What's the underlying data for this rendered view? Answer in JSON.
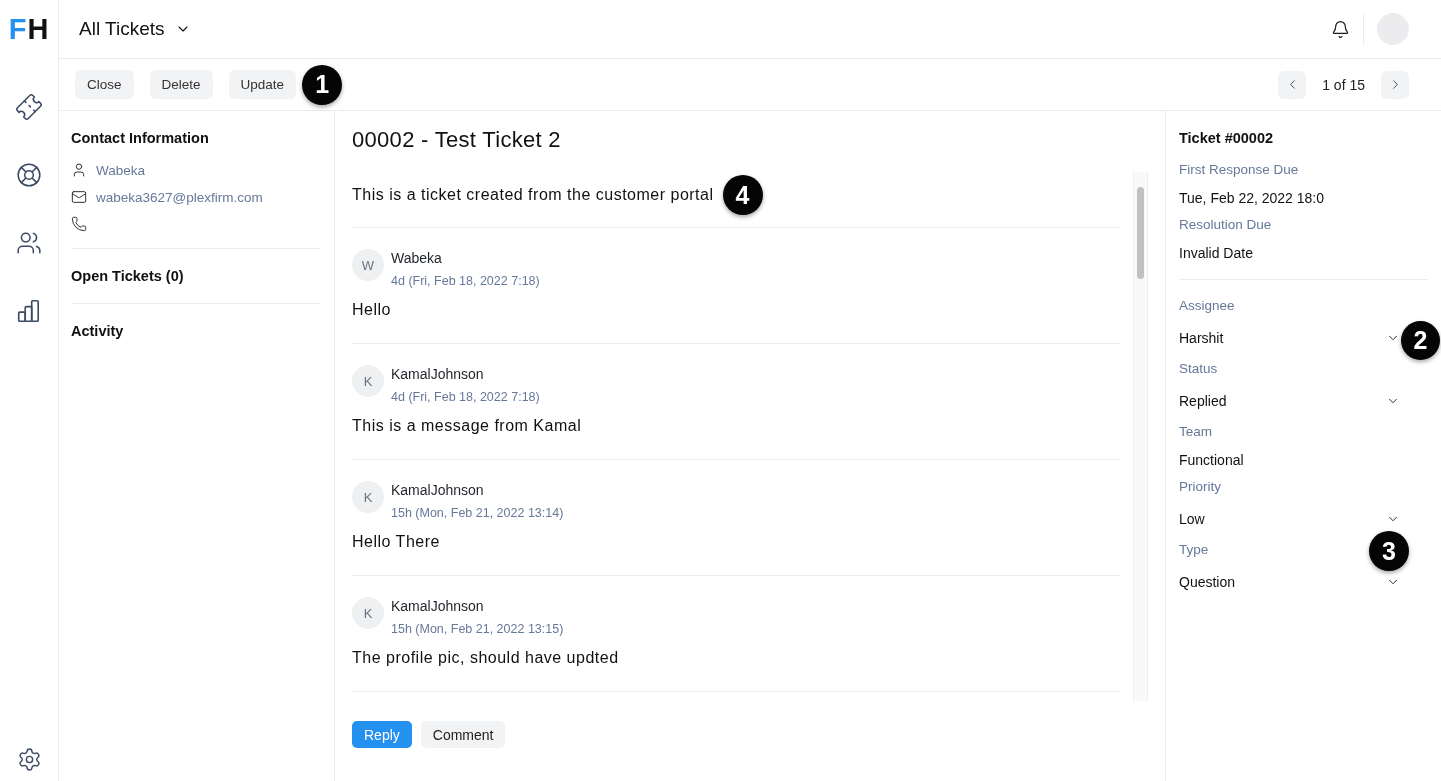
{
  "logo": {
    "accent": "F",
    "rest": "H"
  },
  "header": {
    "title": "All Tickets"
  },
  "toolbar": {
    "buttons": [
      "Close",
      "Delete",
      "Update"
    ],
    "callout": "1",
    "pager": "1 of 15"
  },
  "contact": {
    "heading": "Contact Information",
    "name": "Wabeka",
    "email": "wabeka3627@plexfirm.com",
    "sections": [
      "Open Tickets (0)",
      "Activity"
    ]
  },
  "ticket": {
    "title": "00002 - Test Ticket 2",
    "description": "This is a ticket created from the customer portal",
    "callout": "4",
    "messages": [
      {
        "initial": "W",
        "author": "Wabeka",
        "time": "4d (Fri, Feb 18, 2022 7:18)",
        "body": "Hello"
      },
      {
        "initial": "K",
        "author": "KamalJohnson",
        "time": "4d (Fri, Feb 18, 2022 7:18)",
        "body": "This is a message from Kamal"
      },
      {
        "initial": "K",
        "author": "KamalJohnson",
        "time": "15h (Mon, Feb 21, 2022 13:14)",
        "body": "Hello There"
      },
      {
        "initial": "K",
        "author": "KamalJohnson",
        "time": "15h (Mon, Feb 21, 2022 13:15)",
        "body": "The profile pic, should have updted"
      }
    ]
  },
  "composer": {
    "buttons": [
      {
        "label": "Reply",
        "kind": "primary"
      },
      {
        "label": "Comment",
        "kind": "secondary"
      }
    ]
  },
  "details": {
    "heading": "Ticket #00002",
    "dates": [
      {
        "label": "First Response Due",
        "value": "Tue, Feb 22, 2022 18:0"
      },
      {
        "label": "Resolution Due",
        "value": "Invalid Date"
      }
    ],
    "fields": [
      {
        "label": "Assignee",
        "value": "Harshit",
        "kind": "select",
        "value_callout": "2"
      },
      {
        "label": "Status",
        "value": "Replied",
        "kind": "select"
      },
      {
        "label": "Team",
        "value": "Functional",
        "kind": "text"
      },
      {
        "label": "Priority",
        "value": "Low",
        "kind": "select"
      },
      {
        "label": "Type",
        "value": "Question",
        "kind": "select",
        "label_callout": "3"
      }
    ]
  }
}
